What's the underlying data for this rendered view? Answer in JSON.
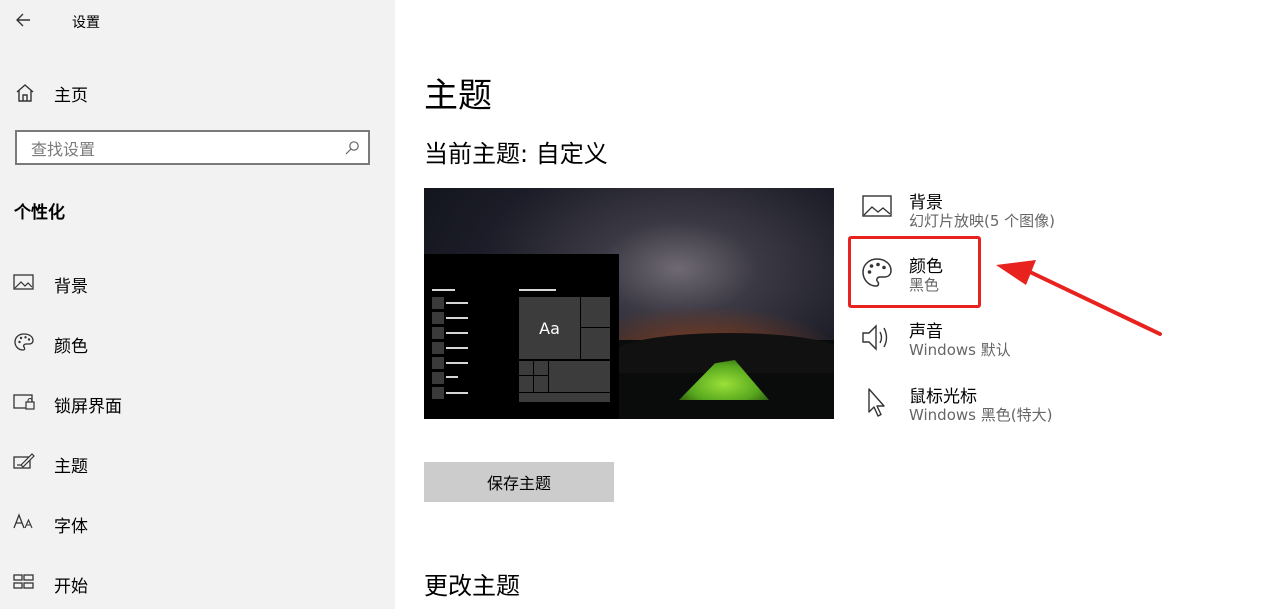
{
  "window": {
    "title": "设置"
  },
  "sidebar": {
    "home_label": "主页",
    "search_placeholder": "查找设置",
    "section_label": "个性化",
    "items": [
      {
        "label": "背景",
        "icon": "image-icon"
      },
      {
        "label": "颜色",
        "icon": "palette-icon"
      },
      {
        "label": "锁屏界面",
        "icon": "lock-screen-icon"
      },
      {
        "label": "主题",
        "icon": "theme-icon"
      },
      {
        "label": "字体",
        "icon": "font-icon"
      },
      {
        "label": "开始",
        "icon": "start-icon"
      }
    ]
  },
  "main": {
    "title": "主题",
    "current_theme": "当前主题: 自定义",
    "preview_tile_label": "Aa",
    "categories": [
      {
        "title": "背景",
        "subtitle": "幻灯片放映(5 个图像)",
        "icon": "image-icon"
      },
      {
        "title": "颜色",
        "subtitle": "黑色",
        "icon": "palette-icon"
      },
      {
        "title": "声音",
        "subtitle": "Windows 默认",
        "icon": "speaker-icon"
      },
      {
        "title": "鼠标光标",
        "subtitle": "Windows 黑色(特大)",
        "icon": "cursor-icon"
      }
    ],
    "save_button": "保存主题",
    "change_theme_heading": "更改主题"
  },
  "annotation": {
    "highlight_color": "#e8231f"
  },
  "colors": {
    "sidebar_bg": "#f2f2f2",
    "button_bg": "#cccccc"
  }
}
